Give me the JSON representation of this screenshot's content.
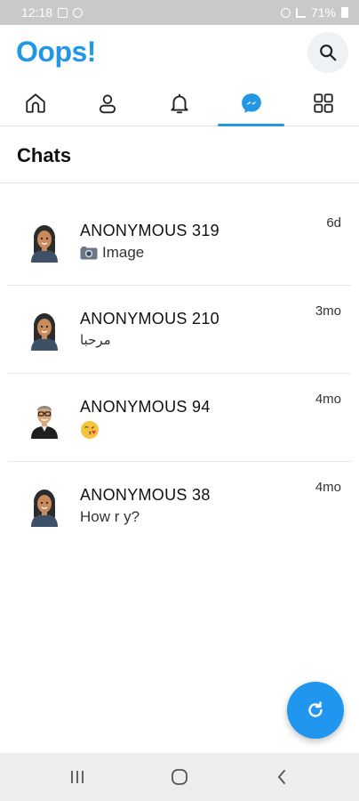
{
  "status_bar": {
    "time": "12:18",
    "battery": "71%"
  },
  "header": {
    "title": "Oops!",
    "search_icon": "search-icon"
  },
  "nav": {
    "tabs": [
      {
        "icon": "home-icon",
        "active": false
      },
      {
        "icon": "profile-icon",
        "active": false
      },
      {
        "icon": "bell-icon",
        "active": false
      },
      {
        "icon": "messenger-icon",
        "active": true
      },
      {
        "icon": "grid-icon",
        "active": false
      }
    ]
  },
  "chats": {
    "title": "Chats",
    "items": [
      {
        "name": "ANONYMOUS 319",
        "preview": "Image",
        "preview_icon": "camera-icon",
        "time": "6d",
        "avatar": "avatar-female"
      },
      {
        "name": "ANONYMOUS 210",
        "preview": "مرحبا",
        "time": "3mo",
        "avatar": "avatar-female"
      },
      {
        "name": "ANONYMOUS 94",
        "preview": "😘",
        "time": "4mo",
        "avatar": "avatar-male"
      },
      {
        "name": "ANONYMOUS 38",
        "preview": "How r y?",
        "time": "4mo",
        "avatar": "avatar-female"
      }
    ]
  },
  "fab": {
    "icon": "refresh-icon"
  },
  "colors": {
    "accent": "#2197e6",
    "fab": "#2196ee"
  }
}
